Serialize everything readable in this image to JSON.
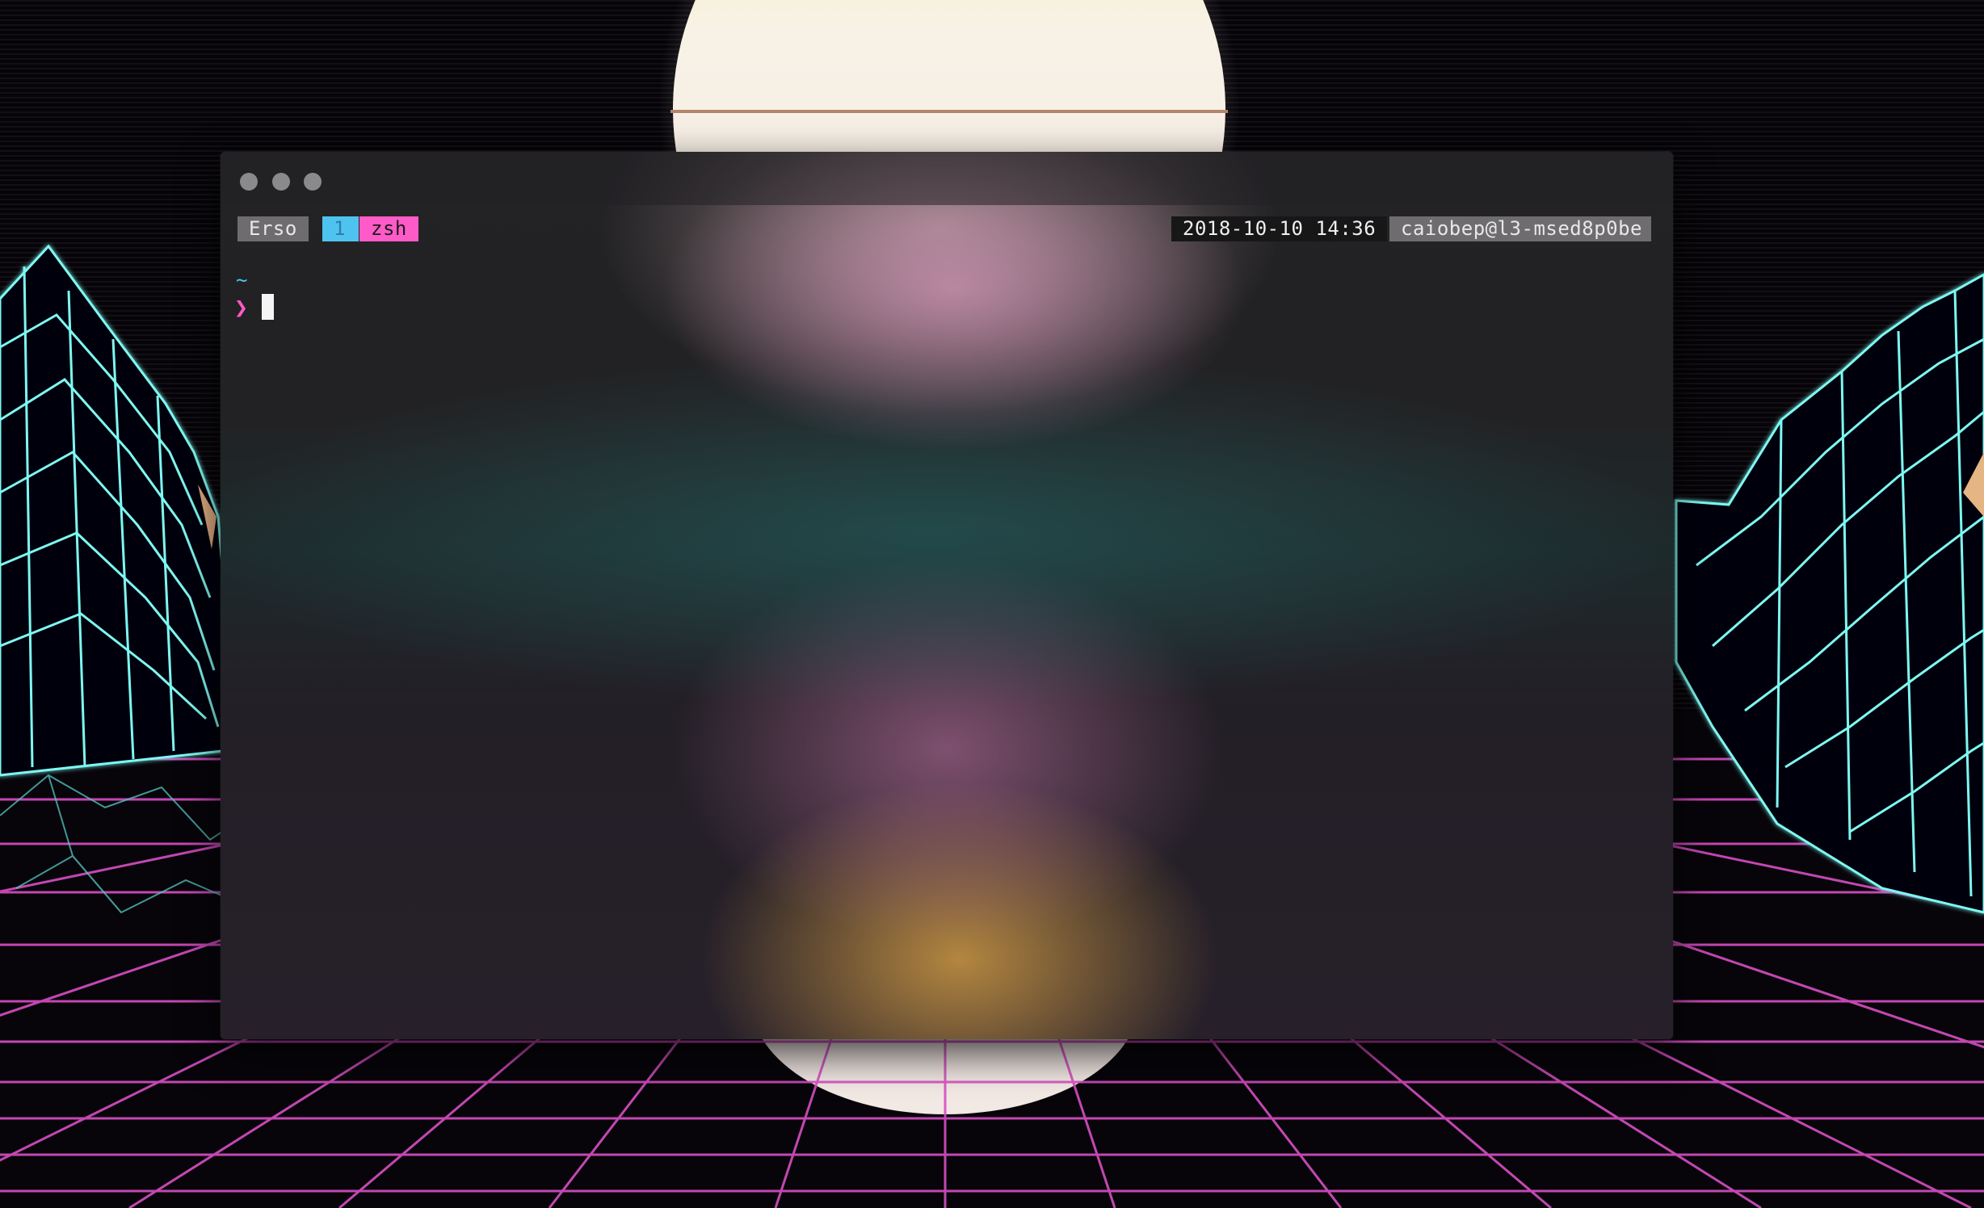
{
  "terminal": {
    "window_controls": [
      "close",
      "minimize",
      "zoom"
    ],
    "status_left": {
      "session": "Erso",
      "window_index": "1",
      "window_name": "zsh"
    },
    "status_right": {
      "datetime": "2018-10-10 14:36",
      "user_host": "caiobep@l3-msed8p0be"
    },
    "prompt": {
      "directory": "~",
      "symbol": "❯"
    }
  },
  "colors": {
    "neon_pink": "#e24fd0",
    "neon_cyan": "#7ef8f2",
    "prompt_pink": "#ff5bc8",
    "prompt_blue": "#4fc3f0",
    "status_gray": "#6f6c6f",
    "status_dark": "#171717"
  },
  "icons": {
    "close": "traffic-light-dot",
    "minimize": "traffic-light-dot",
    "zoom": "traffic-light-dot"
  }
}
